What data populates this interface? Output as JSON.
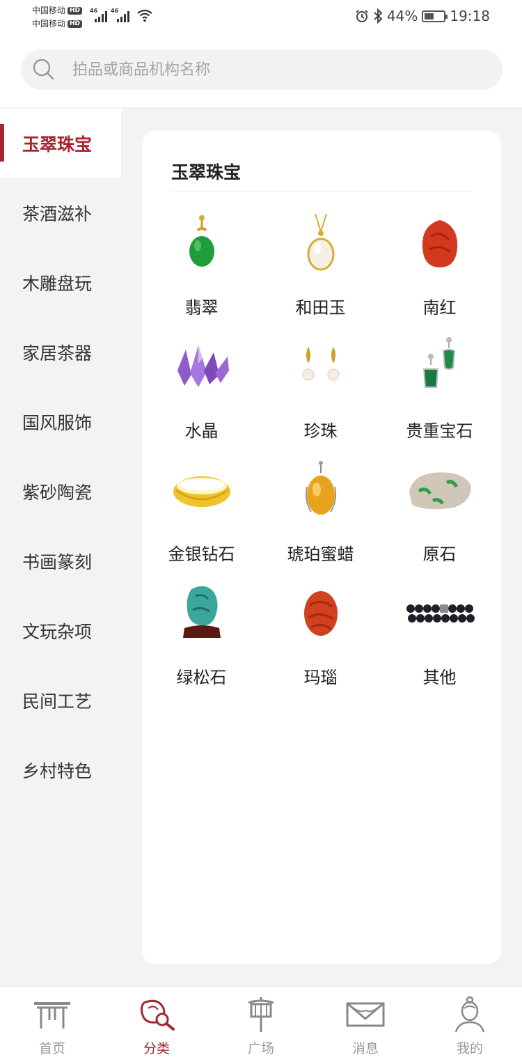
{
  "status_bar": {
    "carrier1": "中国移动",
    "carrier2": "中国移动",
    "hd_badge": "HD",
    "network1": "46",
    "network2": "46",
    "battery": "44%",
    "time": "19:18"
  },
  "search": {
    "placeholder": "拍品或商品机构名称"
  },
  "sidebar": {
    "items": [
      {
        "label": "玉翠珠宝",
        "active": true
      },
      {
        "label": "茶酒滋补"
      },
      {
        "label": "木雕盘玩"
      },
      {
        "label": "家居茶器"
      },
      {
        "label": "国风服饰"
      },
      {
        "label": "紫砂陶瓷"
      },
      {
        "label": "书画篆刻"
      },
      {
        "label": "文玩杂项"
      },
      {
        "label": "民间工艺"
      },
      {
        "label": "乡村特色"
      }
    ]
  },
  "panel": {
    "title": "玉翠珠宝",
    "categories": [
      {
        "label": "翡翠",
        "icon": "jade-pendant-icon"
      },
      {
        "label": "和田玉",
        "icon": "hetian-jade-pendant-icon"
      },
      {
        "label": "南红",
        "icon": "red-agate-icon"
      },
      {
        "label": "水晶",
        "icon": "crystal-icon"
      },
      {
        "label": "珍珠",
        "icon": "pearl-earrings-icon"
      },
      {
        "label": "贵重宝石",
        "icon": "gemstone-earrings-icon"
      },
      {
        "label": "金银钻石",
        "icon": "gold-bangle-icon"
      },
      {
        "label": "琥珀蜜蜡",
        "icon": "amber-pendant-icon"
      },
      {
        "label": "原石",
        "icon": "raw-stone-icon"
      },
      {
        "label": "绿松石",
        "icon": "turquoise-icon"
      },
      {
        "label": "玛瑙",
        "icon": "agate-icon"
      },
      {
        "label": "其他",
        "icon": "bead-bracelet-icon"
      }
    ]
  },
  "tabbar": {
    "tabs": [
      {
        "label": "首页",
        "icon": "home-gate-icon"
      },
      {
        "label": "分类",
        "icon": "category-icon",
        "active": true
      },
      {
        "label": "广场",
        "icon": "plaza-lantern-icon"
      },
      {
        "label": "消息",
        "icon": "message-icon"
      },
      {
        "label": "我的",
        "icon": "profile-icon"
      }
    ]
  },
  "colors": {
    "accent": "#a3272e",
    "background": "#f3f3f4"
  }
}
